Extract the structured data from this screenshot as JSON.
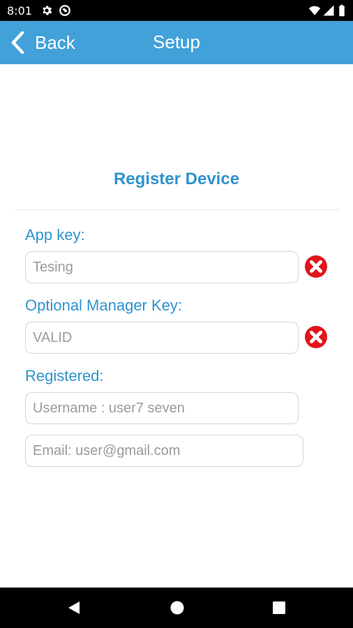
{
  "status_bar": {
    "time": "8:01",
    "icons": [
      "settings-icon",
      "sync-icon",
      "wifi-icon",
      "signal-icon",
      "battery-icon"
    ]
  },
  "app_bar": {
    "back_label": "Back",
    "title": "Setup",
    "color": "#42a1d9"
  },
  "main": {
    "title": "Register Device",
    "app_key": {
      "label": "App key:",
      "value": "Tesing"
    },
    "manager_key": {
      "label": "Optional Manager Key:",
      "value": "VALID"
    },
    "registered": {
      "label": "Registered:",
      "username": "Username : user7 seven",
      "email": "Email: user@gmail.com"
    },
    "accent_color": "#2f93cd",
    "clear_icon_color": "#e3141b"
  },
  "nav_bar": {
    "icons": [
      "back-triangle-icon",
      "home-circle-icon",
      "recents-square-icon"
    ]
  }
}
